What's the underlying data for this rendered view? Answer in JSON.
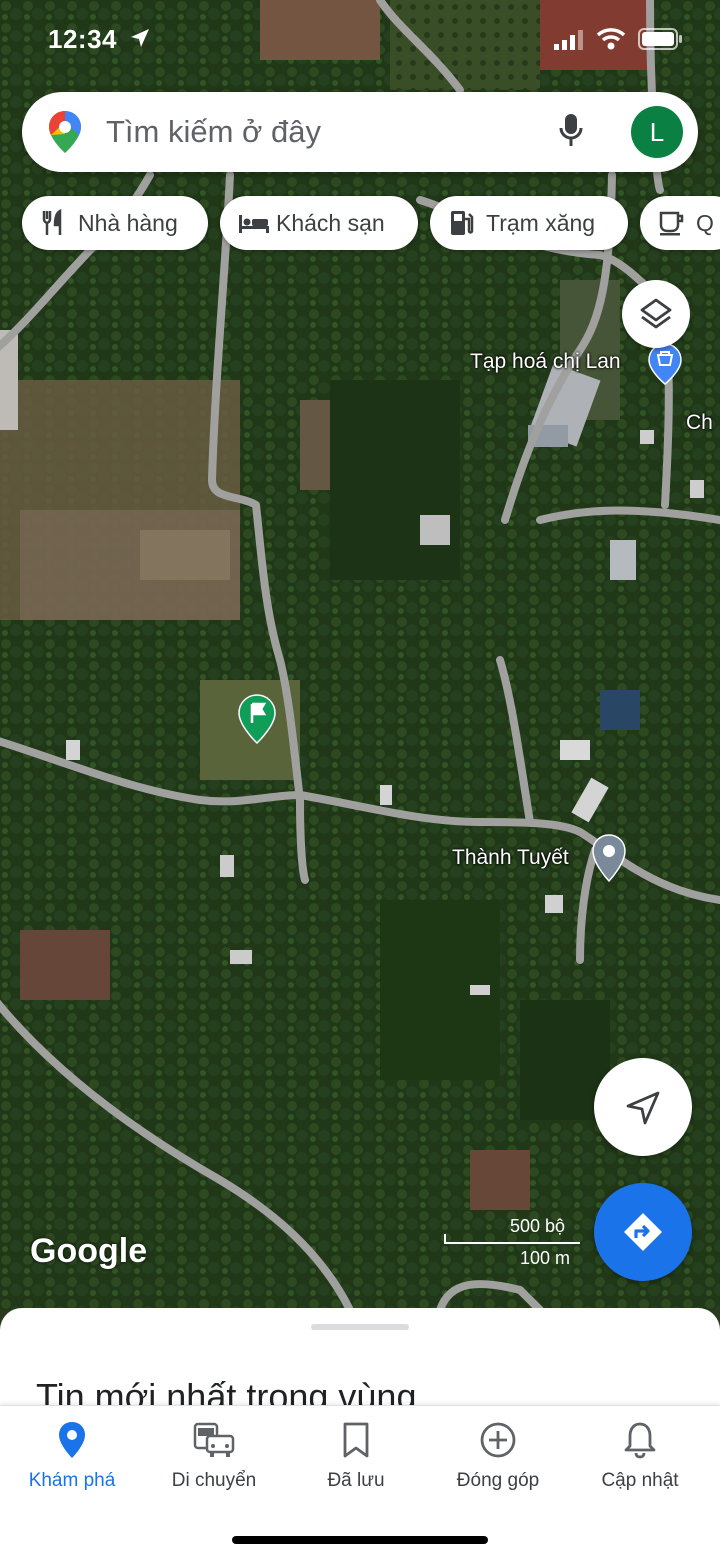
{
  "status_bar": {
    "time": "12:34"
  },
  "search": {
    "placeholder": "Tìm kiếm ở đây",
    "avatar_letter": "L"
  },
  "chips": [
    {
      "label": "Nhà hàng",
      "icon": "restaurant-icon"
    },
    {
      "label": "Khách sạn",
      "icon": "hotel-icon"
    },
    {
      "label": "Trạm xăng",
      "icon": "gas-station-icon"
    },
    {
      "label": "Q",
      "icon": "coffee-icon"
    }
  ],
  "map": {
    "places": [
      {
        "name": "Tạp hoá chị Lan",
        "icon": "shopping-pin-icon"
      },
      {
        "name": "Ch"
      },
      {
        "name": "Thành Tuyết",
        "icon": "place-pin-icon"
      }
    ],
    "watermark": "Google",
    "scale": {
      "imperial": "500 bộ",
      "metric": "100 m"
    }
  },
  "sheet": {
    "title": "Tin mới nhất trong vùng"
  },
  "bottom_nav": [
    {
      "label": "Khám phá",
      "icon": "explore-pin-icon",
      "active": true
    },
    {
      "label": "Di chuyển",
      "icon": "commute-icon",
      "active": false
    },
    {
      "label": "Đã lưu",
      "icon": "bookmark-icon",
      "active": false
    },
    {
      "label": "Đóng góp",
      "icon": "add-circle-icon",
      "active": false
    },
    {
      "label": "Cập nhật",
      "icon": "bell-icon",
      "active": false
    }
  ],
  "colors": {
    "accent": "#1a73e8",
    "avatar": "#0b8043",
    "flag_pin": "#0f9d58"
  }
}
